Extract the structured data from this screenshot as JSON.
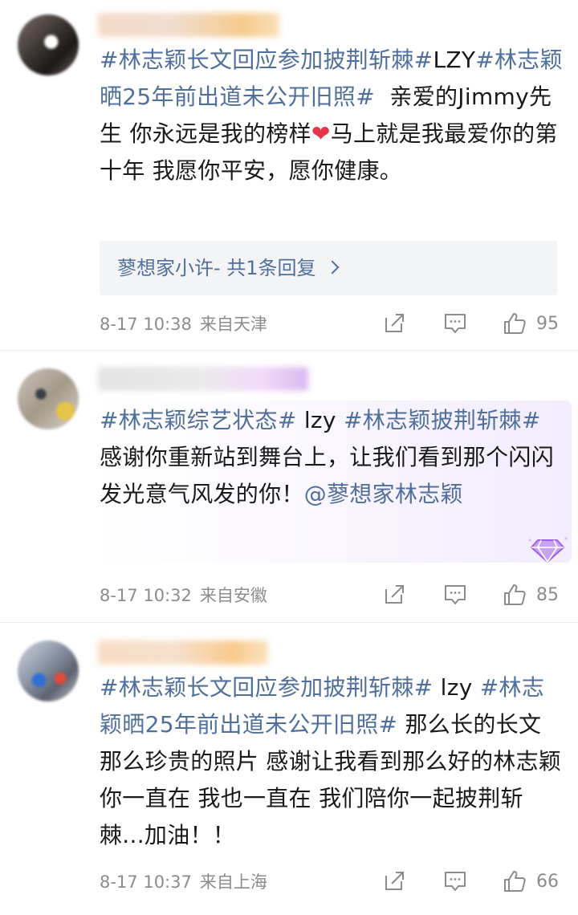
{
  "comments": [
    {
      "text_parts": {
        "tag1": "#林志颖长文回应参加披荆斩棘#",
        "tag2": "LZY",
        "tag3": "#林志颖晒25年前出道未公开旧照#",
        "body1": "  亲爱的Jimmy先生 你永远是我的榜样",
        "heart": "❤",
        "body2": "马上就是我最爱你的第十年 我愿你平安，愿你健康。"
      },
      "reply": {
        "label": "蓼想家小许-  共1条回复"
      },
      "time": "8-17 10:38",
      "location": "来自天津",
      "likes": "95"
    },
    {
      "text_parts": {
        "tag1": "#林志颖综艺状态#",
        "tag2": " lzy ",
        "tag3": "#林志颖披荆斩棘#",
        "body1": " 感谢你重新站到舞台上，让我们看到那个闪闪发光意气风发的你！",
        "mention": "@蓼想家林志颖"
      },
      "time": "8-17 10:32",
      "location": "来自安徽",
      "likes": "85"
    },
    {
      "text_parts": {
        "tag1": "#林志颖长文回应参加披荆斩棘#",
        "tag2": " lzy ",
        "tag3": "#林志颖晒25年前出道未公开旧照#",
        "body1": " 那么长的长文 那么珍贵的照片 感谢让我看到那么好的林志颖 你一直在 我也一直在 我们陪你一起披荆斩棘...加油！！"
      },
      "time": "8-17 10:37",
      "location": "来自上海",
      "likes": "66"
    }
  ],
  "icons": {
    "share": "share-icon",
    "comment": "comment-icon",
    "like": "like-icon",
    "badge": "diamond-badge-icon"
  },
  "colors": {
    "tag": "#4f6f9c",
    "heart": "#e8344a",
    "meta": "#8c8c8c",
    "reply_bg": "#f3f4f6"
  }
}
